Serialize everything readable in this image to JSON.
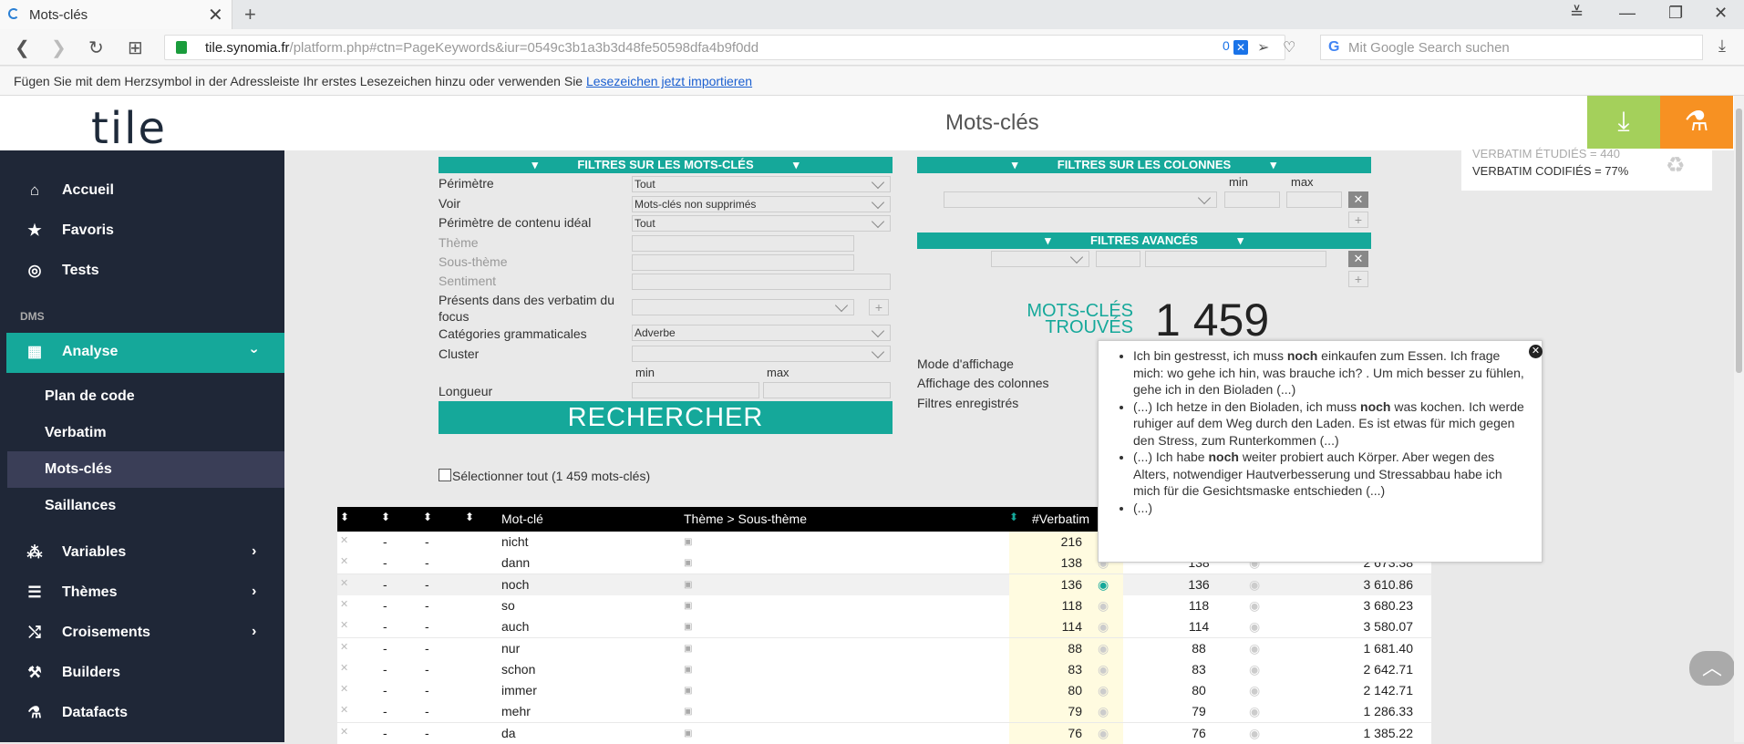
{
  "browser": {
    "tab_title": "Mots-clés",
    "url_host": "tile.synomia.fr",
    "url_path": "/platform.php#ctn=PageKeywords&iur=0549c3b1a3b3d48fe50598dfa4b9f0dd",
    "url_counter": "0",
    "search_placeholder": "Mit Google Search suchen",
    "bookmark_hint": "Fügen Sie mit dem Herzsymbol in der Adressleiste Ihr erstes Lesezeichen hinzu oder verwenden Sie",
    "bookmark_link": "Lesezeichen jetzt importieren"
  },
  "header": {
    "logo": "tile",
    "title": "Mots-clés"
  },
  "sidebar": {
    "items": [
      {
        "label": "Accueil",
        "icon": "home-icon"
      },
      {
        "label": "Favoris",
        "icon": "star-icon"
      },
      {
        "label": "Tests",
        "icon": "target-icon"
      }
    ],
    "section": "DMS",
    "analyse": "Analyse",
    "sub_items": [
      "Plan de code",
      "Verbatim",
      "Mots-clés",
      "Saillances"
    ],
    "more_items": [
      {
        "label": "Variables",
        "icon": "variables-icon"
      },
      {
        "label": "Thèmes",
        "icon": "list-icon"
      },
      {
        "label": "Croisements",
        "icon": "cross-icon"
      },
      {
        "label": "Builders",
        "icon": "tools-icon"
      },
      {
        "label": "Datafacts",
        "icon": "flask-icon"
      }
    ]
  },
  "filters": {
    "kw_title": "FILTRES SUR LES MOTS-CLÉS",
    "col_title": "FILTRES SUR LES COLONNES",
    "adv_title": "FILTRES AVANCÉS",
    "perimetre": "Périmètre",
    "perimetre_val": "Tout",
    "voir": "Voir",
    "voir_val": "Mots-clés non supprimés",
    "perimetre_ideal": "Périmètre de contenu idéal",
    "perimetre_ideal_val": "Tout",
    "theme": "Thème",
    "sous_theme": "Sous-thème",
    "sentiment": "Sentiment",
    "presents": "Présents dans des verbatim du focus",
    "categories": "Catégories grammaticales",
    "categories_val": "Adverbe",
    "cluster": "Cluster",
    "min": "min",
    "max": "max",
    "longueur": "Longueur",
    "rechercher": "RECHERCHER",
    "select_all": "Sélectionner tout (1 459 mots-clés)"
  },
  "results": {
    "label_line1": "MOTS-CLÉS",
    "label_line2": "TROUVÉS",
    "count": "1 459",
    "mode": "Mode d'affichage",
    "affichage_cols": "Affichage des colonnes",
    "filtres_enr": "Filtres enregistrés"
  },
  "stats": {
    "line1": "VERBATIM ÉTUDIÉS = 440",
    "line2": "VERBATIM CODIFIÉS = 77%"
  },
  "table": {
    "headers": {
      "keyword": "Mot-clé",
      "theme": "Thème > Sous-thème",
      "verbatim": "#Verbatim"
    },
    "rows": [
      {
        "kw": "nicht",
        "v": "216",
        "v2": "",
        "score": ""
      },
      {
        "kw": "dann",
        "v": "138",
        "v2": "138",
        "score": "2 673.38"
      },
      {
        "kw": "noch",
        "v": "136",
        "v2": "136",
        "score": "3 610.86"
      },
      {
        "kw": "so",
        "v": "118",
        "v2": "118",
        "score": "3 680.23"
      },
      {
        "kw": "auch",
        "v": "114",
        "v2": "114",
        "score": "3 580.07"
      },
      {
        "kw": "nur",
        "v": "88",
        "v2": "88",
        "score": "1 681.40"
      },
      {
        "kw": "schon",
        "v": "83",
        "v2": "83",
        "score": "2 642.71"
      },
      {
        "kw": "immer",
        "v": "80",
        "v2": "80",
        "score": "2 142.71"
      },
      {
        "kw": "mehr",
        "v": "79",
        "v2": "79",
        "score": "1 286.33"
      },
      {
        "kw": "da",
        "v": "76",
        "v2": "76",
        "score": "1 385.22"
      }
    ]
  },
  "popup": {
    "items": [
      {
        "pre": "Ich bin gestresst, ich muss ",
        "kw": "noch",
        "post": " einkaufen zum Essen. Ich frage mich: wo gehe ich hin, was brauche ich? . Um mich besser zu fühlen, gehe ich in den Bioladen (...)"
      },
      {
        "pre": "(...) Ich hetze in den Bioladen, ich muss ",
        "kw": "noch",
        "post": " was kochen. Ich werde ruhiger auf dem Weg durch den Laden. Es ist etwas für mich gegen den Stress, zum Runterkommen (...)"
      },
      {
        "pre": "(...) Ich habe ",
        "kw": "noch",
        "post": " weiter probiert auch Körper. Aber wegen des Alters, notwendiger Hautverbesserung und Stressabbau habe ich mich für die Gesichtsmaske entschieden (...)"
      },
      {
        "pre": "(...)",
        "kw": "",
        "post": ""
      }
    ]
  }
}
